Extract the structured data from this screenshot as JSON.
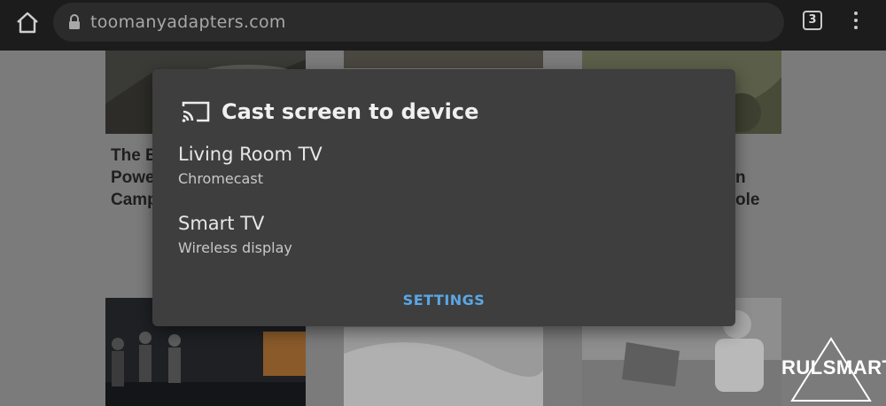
{
  "browser": {
    "url": "toomanyadapters.com",
    "tab_count": "3",
    "icons": {
      "home": "home-icon",
      "lock": "lock-icon",
      "menu": "more-vert-icon"
    }
  },
  "background_cards": [
    {
      "title_fragment": "The B",
      "line2": "Powe",
      "line3": "Camp"
    },
    {
      "title_fragment": "n",
      "line2": "ole"
    }
  ],
  "cast_dialog": {
    "title": "Cast screen to device",
    "icon": "cast-icon",
    "devices": [
      {
        "name": "Living Room TV",
        "type": "Chromecast"
      },
      {
        "name": "Smart TV",
        "type": "Wireless display"
      }
    ],
    "settings_label": "SETTINGS"
  },
  "watermark": {
    "text": "RULSMART"
  },
  "colors": {
    "dialog_bg": "#3e3e3e",
    "accent": "#5aa7e6",
    "topbar_bg": "#1c1c1c"
  }
}
